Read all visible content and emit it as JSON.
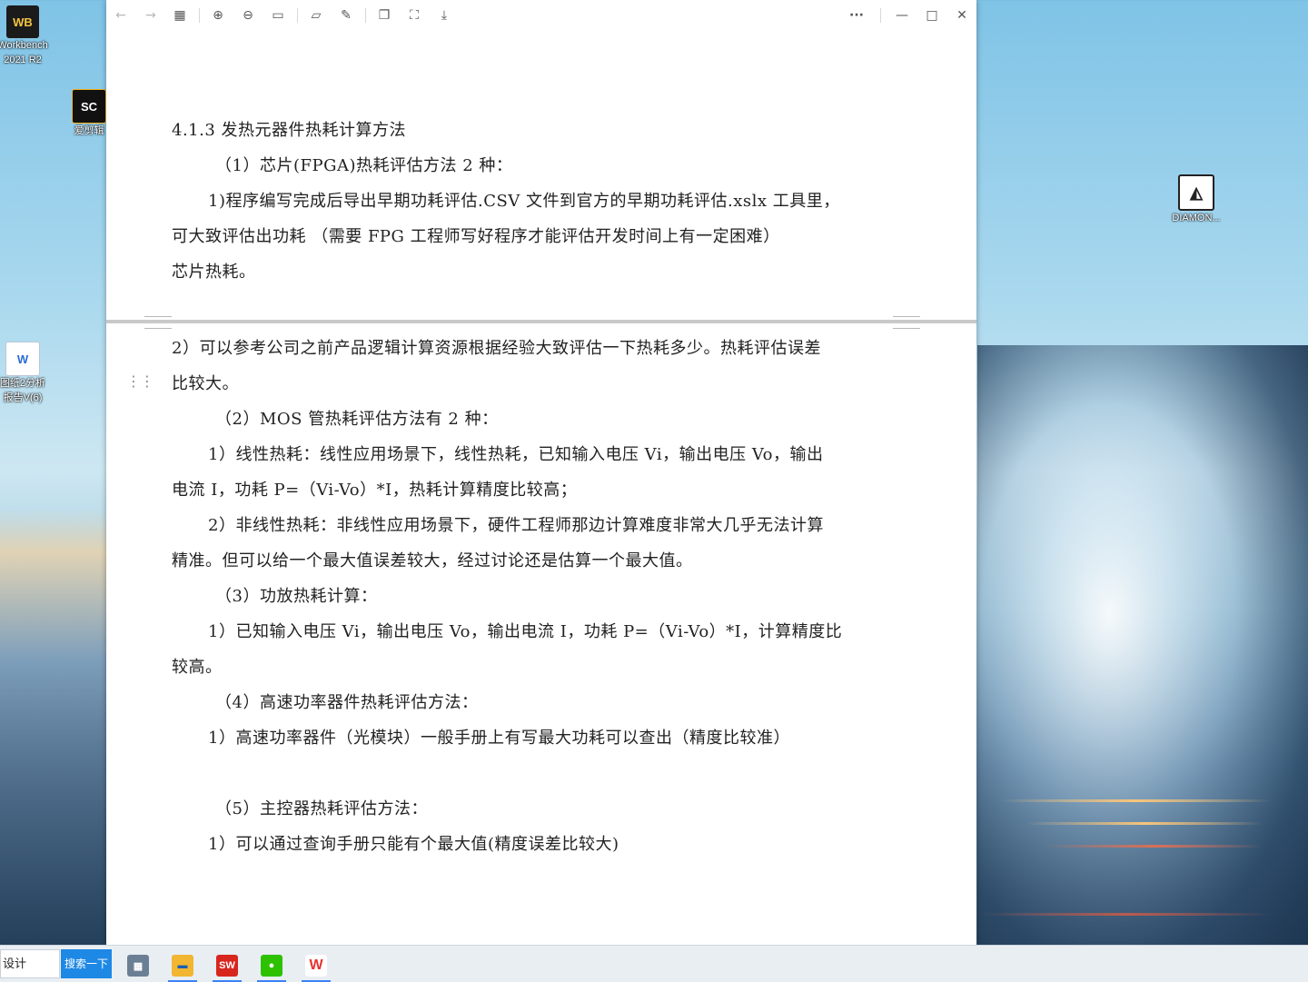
{
  "desktop": {
    "icons": [
      {
        "label": "Workbench\n2021 R2",
        "glyph": "WB"
      },
      {
        "label": "爱剪辑",
        "glyph": "SC"
      },
      {
        "label": "图纸2分析\n报告V(6)",
        "glyph": "W"
      },
      {
        "label": "DIAMON...",
        "glyph": "◭"
      }
    ]
  },
  "toolbar": {
    "back_icon": "←",
    "forward_icon": "→",
    "grid_icon": "▦",
    "zoom_in_icon": "⊕",
    "zoom_out_icon": "⊖",
    "fit_icon": "▭",
    "folder_icon": "▱",
    "edit_icon": "✎",
    "copy_icon": "❐",
    "fullscreen_icon": "⛶",
    "download_icon": "⤓",
    "more_icon": "···",
    "minimize_icon": "—",
    "maximize_icon": "□",
    "close_icon": "✕"
  },
  "document": {
    "page1": [
      "4.1.3 发热元器件热耗计算方法",
      "（1）芯片(FPGA)热耗评估方法 2 种：",
      "1)程序编写完成后导出早期功耗评估.CSV 文件到官方的早期功耗评估.xslx 工具里，",
      "可大致评估出功耗 （需要 FPG 工程师写好程序才能评估开发时间上有一定困难）",
      "芯片热耗。"
    ],
    "page2": [
      "2）可以参考公司之前产品逻辑计算资源根据经验大致评估一下热耗多少。热耗评估误差",
      "比较大。",
      "（2）MOS 管热耗评估方法有 2 种：",
      "1）线性热耗：线性应用场景下，线性热耗，已知输入电压 Vi，输出电压 Vo，输出",
      "电流 I，功耗 P=（Vi-Vo）*I，热耗计算精度比较高；",
      "2）非线性热耗：非线性应用场景下，硬件工程师那边计算难度非常大几乎无法计算",
      "精准。但可以给一个最大值误差较大，经过讨论还是估算一个最大值。",
      "（3）功放热耗计算：",
      "1）已知输入电压 Vi，输出电压 Vo，输出电流 I，功耗 P=（Vi-Vo）*I，计算精度比",
      "较高。",
      "（4）高速功率器件热耗评估方法：",
      "1）高速功率器件（光模块）一般手册上有写最大功耗可以查出（精度比较准）",
      "（5）主控器热耗评估方法：",
      "1）可以通过查询手册只能有个最大值(精度误差比较大)"
    ]
  },
  "taskbar": {
    "input_value": "设计",
    "search_label": "搜索一下",
    "apps": [
      {
        "name": "calculator",
        "glyph": "▦",
        "color": "#6b7f94"
      },
      {
        "name": "file-explorer",
        "glyph": "▬",
        "color": "#f2b632"
      },
      {
        "name": "solidworks",
        "glyph": "SW",
        "color": "#d7261e"
      },
      {
        "name": "wechat",
        "glyph": "●",
        "color": "#2dc100"
      },
      {
        "name": "wps",
        "glyph": "W",
        "color": "#e8322f"
      }
    ]
  }
}
